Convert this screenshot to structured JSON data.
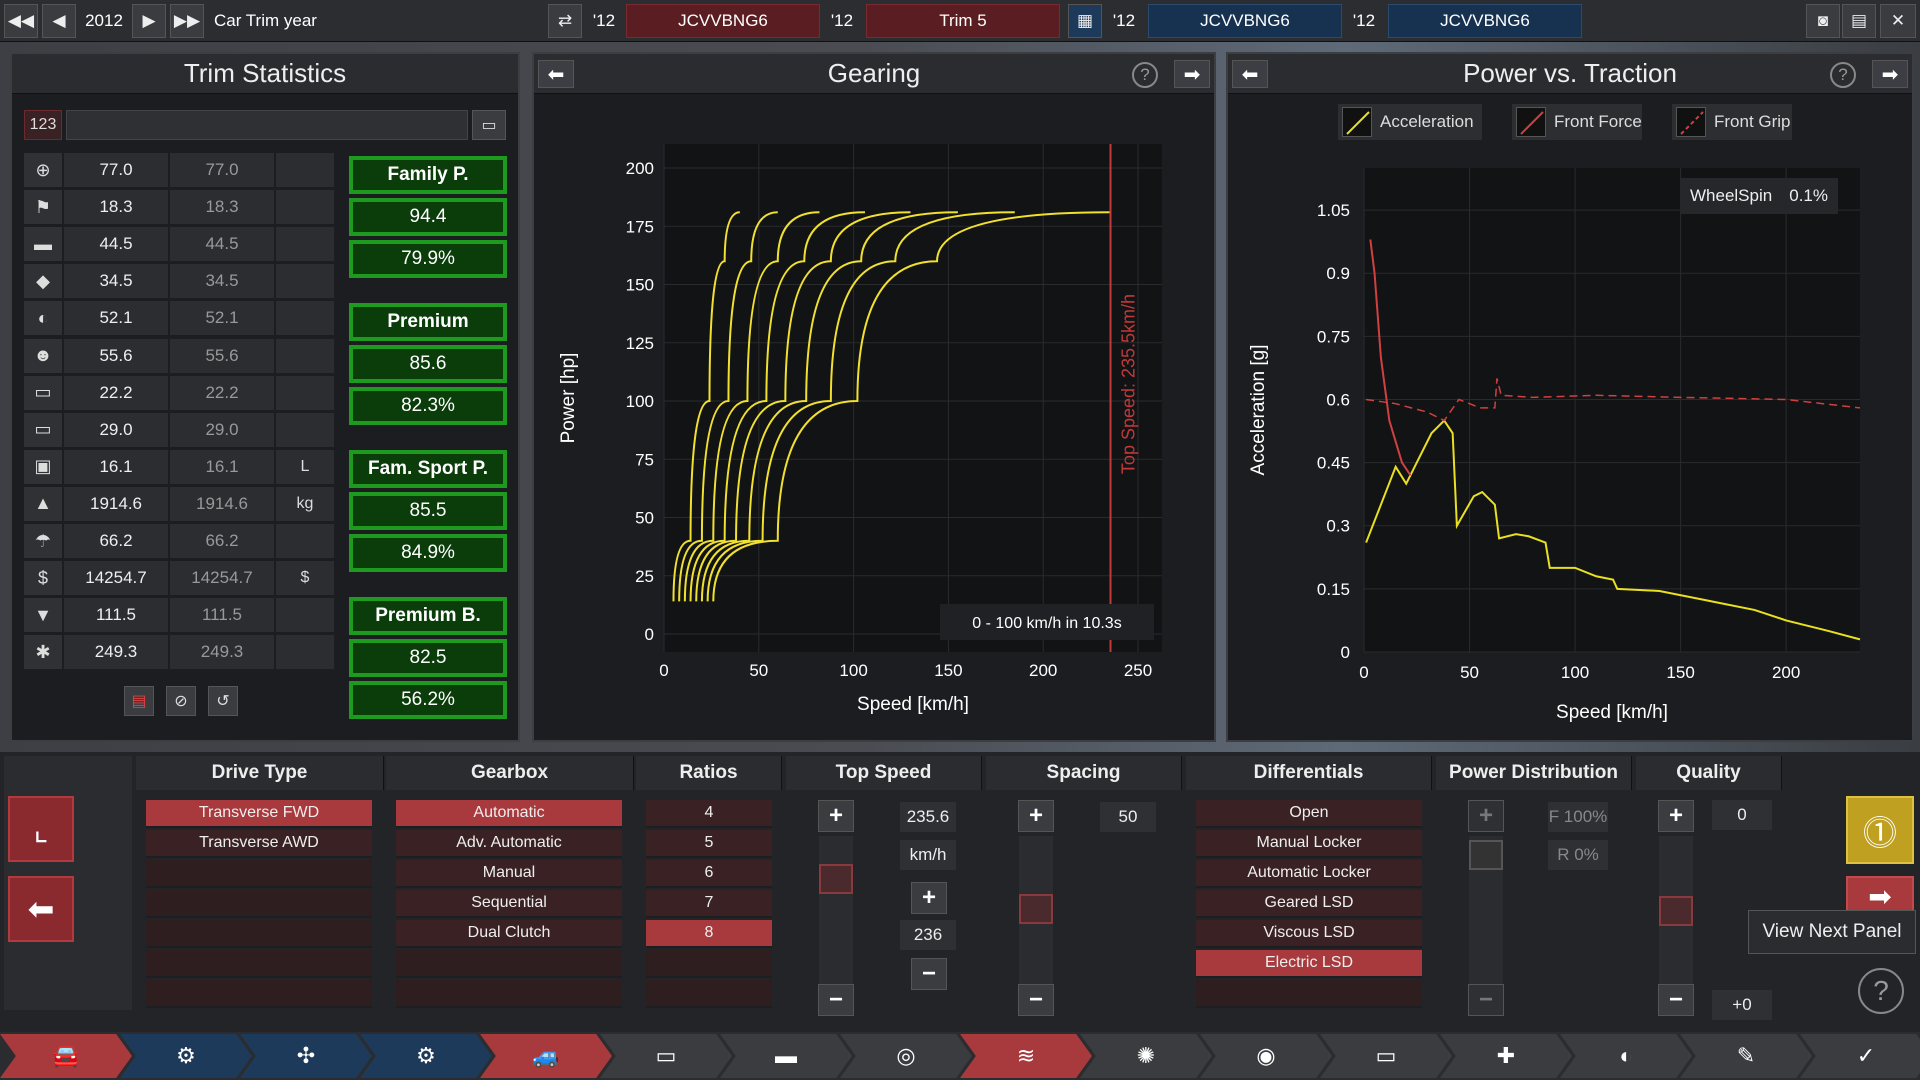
{
  "topbar": {
    "year": "2012",
    "label": "Car Trim year",
    "yr1": "'12",
    "slot1": "JCVVBNG6",
    "yr2": "'12",
    "slot2": "Trim 5",
    "yr3": "'12",
    "slot3": "JCVVBNG6",
    "yr4": "'12",
    "slot4": "JCVVBNG6"
  },
  "trim": {
    "title": "Trim Statistics",
    "badge": "123",
    "rows": [
      [
        "77.0",
        "77.0",
        ""
      ],
      [
        "18.3",
        "18.3",
        ""
      ],
      [
        "44.5",
        "44.5",
        ""
      ],
      [
        "34.5",
        "34.5",
        ""
      ],
      [
        "52.1",
        "52.1",
        ""
      ],
      [
        "55.6",
        "55.6",
        ""
      ],
      [
        "22.2",
        "22.2",
        ""
      ],
      [
        "29.0",
        "29.0",
        ""
      ],
      [
        "16.1",
        "16.1",
        "L"
      ],
      [
        "1914.6",
        "1914.6",
        "kg"
      ],
      [
        "66.2",
        "66.2",
        ""
      ],
      [
        "14254.7",
        "14254.7",
        "$"
      ],
      [
        "111.5",
        "111.5",
        ""
      ],
      [
        "249.3",
        "249.3",
        ""
      ]
    ],
    "groups": [
      {
        "name": "Family P.",
        "a": "94.4",
        "b": "79.9%"
      },
      {
        "name": "Premium",
        "a": "85.6",
        "b": "82.3%"
      },
      {
        "name": "Fam. Sport P.",
        "a": "85.5",
        "b": "84.9%"
      },
      {
        "name": "Premium B.",
        "a": "82.5",
        "b": "56.2%"
      }
    ]
  },
  "gearing": {
    "title": "Gearing",
    "note": "0 - 100 km/h in 10.3s"
  },
  "pvt": {
    "title": "Power vs. Traction",
    "legend": [
      "Acceleration",
      "Front Force",
      "Front Grip"
    ],
    "wheelspin_label": "WheelSpin",
    "wheelspin_value": "0.1%"
  },
  "chart_data": [
    {
      "type": "line",
      "xlabel": "Speed [km/h]",
      "ylabel": "Power [hp]",
      "xlim": [
        0,
        250
      ],
      "ylim": [
        0,
        200
      ],
      "xticks": [
        "0",
        "50",
        "100",
        "150",
        "200",
        "250"
      ],
      "yticks": [
        "0",
        "25",
        "50",
        "75",
        "100",
        "125",
        "150",
        "175",
        "200"
      ],
      "annotation": "Top Speed: 235.5km/h",
      "top_speed": 235.5,
      "grid": true,
      "series": [
        {
          "values": [
            [
              5,
              14
            ],
            [
              14,
              40
            ],
            [
              24,
              100
            ],
            [
              32,
              160
            ],
            [
              40,
              181
            ]
          ]
        },
        {
          "values": [
            [
              8,
              14
            ],
            [
              20,
              40
            ],
            [
              34,
              100
            ],
            [
              46,
              160
            ],
            [
              60,
              181
            ]
          ]
        },
        {
          "values": [
            [
              11,
              14
            ],
            [
              26,
              40
            ],
            [
              44,
              100
            ],
            [
              60,
              160
            ],
            [
              82,
              181
            ]
          ]
        },
        {
          "values": [
            [
              14,
              14
            ],
            [
              32,
              40
            ],
            [
              54,
              100
            ],
            [
              74,
              160
            ],
            [
              106,
              181
            ]
          ]
        },
        {
          "values": [
            [
              17,
              14
            ],
            [
              38,
              40
            ],
            [
              64,
              100
            ],
            [
              88,
              160
            ],
            [
              130,
              181
            ]
          ]
        },
        {
          "values": [
            [
              20,
              14
            ],
            [
              45,
              40
            ],
            [
              75,
              100
            ],
            [
              104,
              160
            ],
            [
              155,
              181
            ]
          ]
        },
        {
          "values": [
            [
              23,
              14
            ],
            [
              52,
              40
            ],
            [
              88,
              100
            ],
            [
              122,
              160
            ],
            [
              185,
              181
            ]
          ]
        },
        {
          "values": [
            [
              26,
              14
            ],
            [
              60,
              40
            ],
            [
              102,
              100
            ],
            [
              144,
              160
            ],
            [
              235,
              181
            ]
          ]
        }
      ]
    },
    {
      "type": "line",
      "xlabel": "Speed [km/h]",
      "ylabel": "Acceleration [g]",
      "xlim": [
        0,
        235
      ],
      "ylim": [
        0,
        1.15
      ],
      "xticks": [
        "0",
        "50",
        "100",
        "150",
        "200"
      ],
      "yticks": [
        "0",
        "0.15",
        "0.3",
        "0.45",
        "0.6",
        "0.75",
        "0.9",
        "1.05"
      ],
      "grid": true,
      "series": [
        {
          "name": "Acceleration",
          "color": "#e8e020",
          "values": [
            [
              1,
              0.26
            ],
            [
              8,
              0.35
            ],
            [
              15,
              0.44
            ],
            [
              20,
              0.4
            ],
            [
              25,
              0.45
            ],
            [
              32,
              0.52
            ],
            [
              38,
              0.55
            ],
            [
              42,
              0.52
            ],
            [
              44,
              0.3
            ],
            [
              52,
              0.37
            ],
            [
              56,
              0.38
            ],
            [
              62,
              0.35
            ],
            [
              64,
              0.27
            ],
            [
              72,
              0.28
            ],
            [
              78,
              0.275
            ],
            [
              86,
              0.26
            ],
            [
              88,
              0.2
            ],
            [
              100,
              0.2
            ],
            [
              110,
              0.18
            ],
            [
              118,
              0.172
            ],
            [
              120,
              0.15
            ],
            [
              140,
              0.145
            ],
            [
              160,
              0.125
            ],
            [
              170,
              0.115
            ],
            [
              185,
              0.1
            ],
            [
              200,
              0.075
            ],
            [
              220,
              0.05
            ],
            [
              235,
              0.03
            ]
          ]
        },
        {
          "name": "Front Force",
          "color": "#d04040",
          "values": [
            [
              3,
              0.98
            ],
            [
              5,
              0.9
            ],
            [
              8,
              0.7
            ],
            [
              12,
              0.55
            ],
            [
              18,
              0.45
            ],
            [
              22,
              0.42
            ]
          ]
        },
        {
          "name": "Front Grip",
          "color": "#d04040",
          "dashed": true,
          "values": [
            [
              1,
              0.6
            ],
            [
              15,
              0.59
            ],
            [
              30,
              0.57
            ],
            [
              38,
              0.55
            ],
            [
              45,
              0.6
            ],
            [
              55,
              0.58
            ],
            [
              62,
              0.58
            ],
            [
              63,
              0.65
            ],
            [
              65,
              0.61
            ],
            [
              80,
              0.605
            ],
            [
              110,
              0.61
            ],
            [
              150,
              0.605
            ],
            [
              200,
              0.6
            ],
            [
              235,
              0.58
            ]
          ]
        }
      ]
    }
  ],
  "bottom": {
    "heads": [
      "Drive Type",
      "Gearbox",
      "Ratios",
      "Top Speed",
      "Spacing",
      "Differentials",
      "Power Distribution",
      "Quality"
    ],
    "drive": [
      "Transverse FWD",
      "Transverse AWD"
    ],
    "gearbox": [
      "Automatic",
      "Adv. Automatic",
      "Manual",
      "Sequential",
      "Dual Clutch"
    ],
    "ratios": [
      "4",
      "5",
      "6",
      "7",
      "8"
    ],
    "topspeed": {
      "value": "235.6",
      "unit": "km/h",
      "step": "236"
    },
    "spacing": {
      "value": "50"
    },
    "diffs": [
      "Open",
      "Manual Locker",
      "Automatic Locker",
      "Geared LSD",
      "Viscous LSD",
      "Electric LSD"
    ],
    "powerdist": {
      "front": "F 100%",
      "rear": "R 0%"
    },
    "quality": {
      "value": "0",
      "delta": "+0"
    },
    "tooltip": "View Next Panel"
  },
  "tabs": [
    "car",
    "engine",
    "engine-parts",
    "engine-tune",
    "chassis",
    "body",
    "fixture",
    "aero",
    "suspension",
    "wheels",
    "brakes",
    "interior",
    "safety",
    "test",
    "drive",
    "check"
  ]
}
